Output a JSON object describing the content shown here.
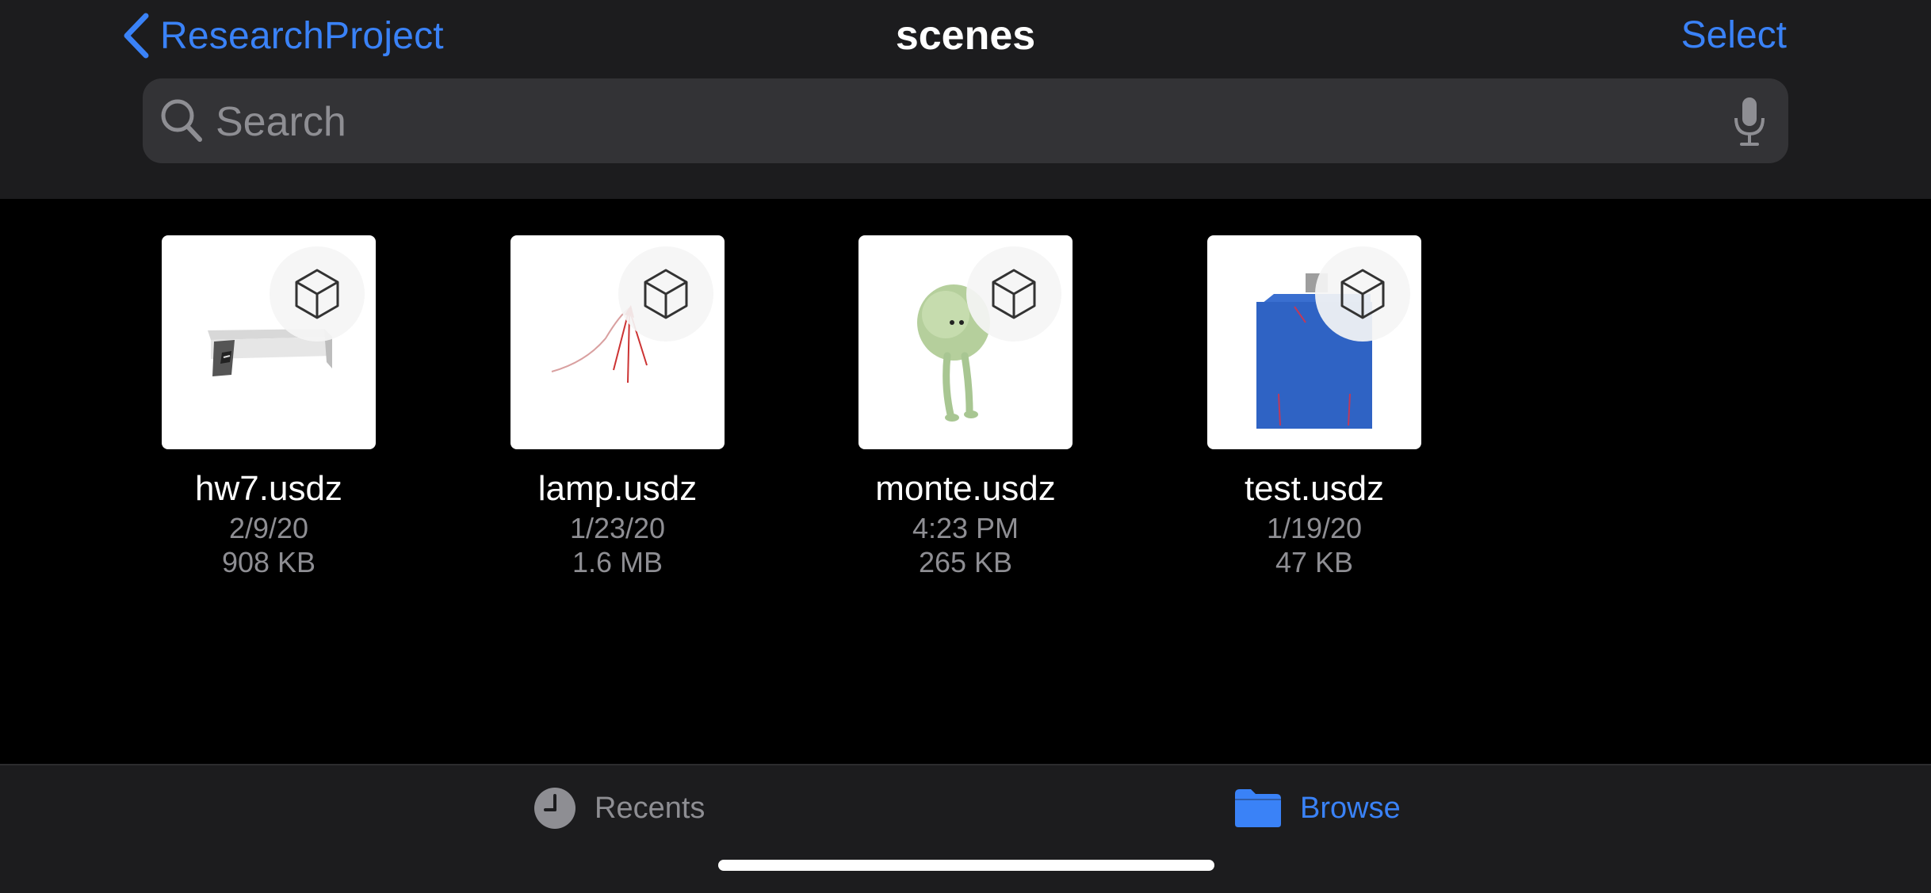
{
  "nav": {
    "back_label": "ResearchProject",
    "title": "scenes",
    "select_label": "Select"
  },
  "search": {
    "placeholder": "Search",
    "value": "",
    "icon": "magnifying-glass",
    "mic_icon": "microphone"
  },
  "files": [
    {
      "name": "hw7.usdz",
      "date": "2/9/20",
      "size": "908 KB",
      "badge_icon": "ar-cube"
    },
    {
      "name": "lamp.usdz",
      "date": "1/23/20",
      "size": "1.6 MB",
      "badge_icon": "ar-cube"
    },
    {
      "name": "monte.usdz",
      "date": "4:23 PM",
      "size": "265 KB",
      "badge_icon": "ar-cube"
    },
    {
      "name": "test.usdz",
      "date": "1/19/20",
      "size": "47 KB",
      "badge_icon": "ar-cube"
    }
  ],
  "tabbar": {
    "tabs": [
      {
        "label": "Recents",
        "icon": "clock",
        "selected": false
      },
      {
        "label": "Browse",
        "icon": "folder",
        "selected": true
      }
    ]
  },
  "colors": {
    "accent": "#3a82f7",
    "header_bg": "#1c1c1e",
    "content_bg": "#000000",
    "search_bg": "#333336",
    "secondary_text": "#8e8e93"
  }
}
